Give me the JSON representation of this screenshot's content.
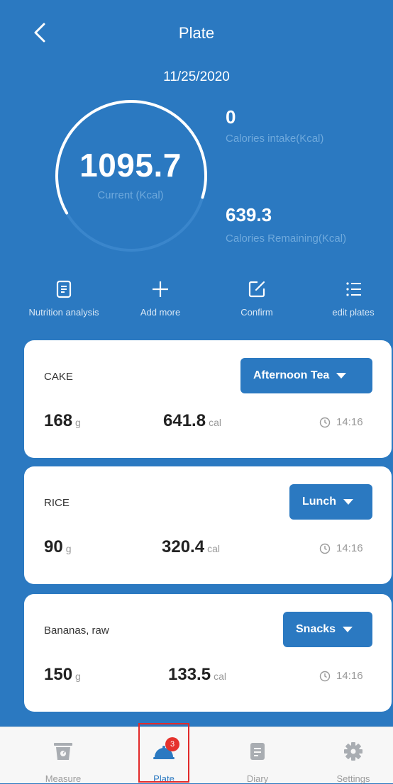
{
  "header": {
    "title": "Plate"
  },
  "date": "11/25/2020",
  "summary": {
    "current_value": "1095.7",
    "current_label": "Current (Kcal)",
    "intake_value": "0",
    "intake_label": "Calories intake(Kcal)",
    "remaining_value": "639.3",
    "remaining_label": "Calories Remaining(Kcal)",
    "ring_progress": 0.63
  },
  "actions": [
    {
      "label": "Nutrition analysis",
      "icon": "document-icon"
    },
    {
      "label": "Add more",
      "icon": "plus-icon"
    },
    {
      "label": "Confirm",
      "icon": "edit-icon"
    },
    {
      "label": "edit plates",
      "icon": "list-icon"
    }
  ],
  "items": [
    {
      "name": "CAKE",
      "meal": "Afternoon Tea",
      "weight": "168",
      "weight_unit": "g",
      "calories": "641.8",
      "cal_unit": "cal",
      "time": "14:16"
    },
    {
      "name": "RICE",
      "meal": "Lunch",
      "weight": "90",
      "weight_unit": "g",
      "calories": "320.4",
      "cal_unit": "cal",
      "time": "14:16"
    },
    {
      "name": "Bananas, raw",
      "meal": "Snacks",
      "weight": "150",
      "weight_unit": "g",
      "calories": "133.5",
      "cal_unit": "cal",
      "time": "14:16"
    }
  ],
  "tabs": [
    {
      "label": "Measure",
      "icon": "scale-icon"
    },
    {
      "label": "Plate",
      "icon": "plate-icon",
      "badge": "3",
      "active": true
    },
    {
      "label": "Diary",
      "icon": "diary-icon"
    },
    {
      "label": "Settings",
      "icon": "gear-icon"
    }
  ],
  "colors": {
    "primary": "#2b79c1",
    "badge": "#e5322d",
    "muted_label": "#6fa9dc"
  }
}
